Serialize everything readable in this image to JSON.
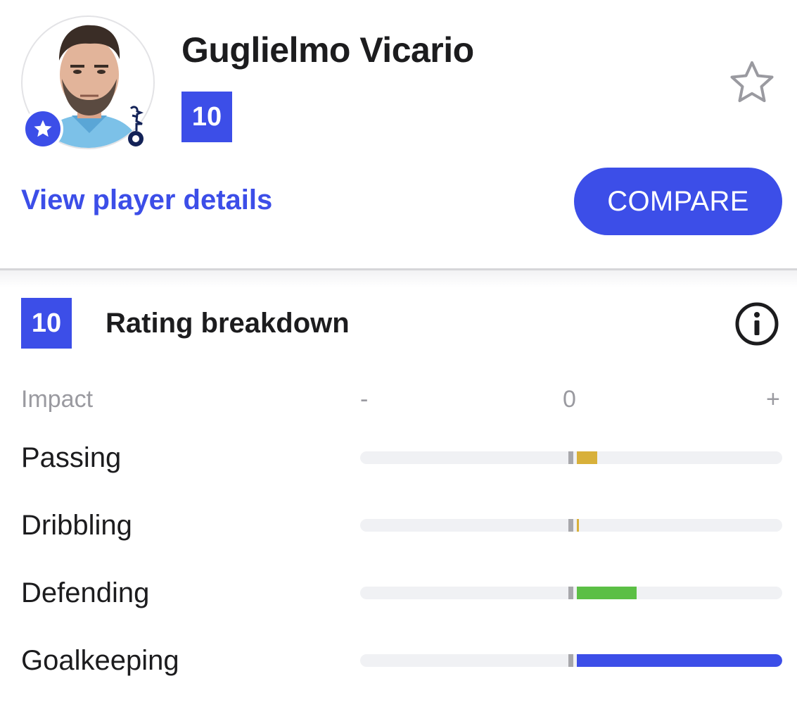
{
  "player": {
    "name": "Guglielmo Vicario",
    "rating": "10",
    "details_link": "View player details",
    "compare_label": "COMPARE"
  },
  "breakdown": {
    "rating": "10",
    "title": "Rating breakdown",
    "impact_label": "Impact",
    "scale": {
      "minus": "-",
      "zero": "0",
      "plus": "+"
    },
    "metrics": [
      {
        "label": "Passing",
        "impact": 0.1,
        "color": "#d8b03a"
      },
      {
        "label": "Dribbling",
        "impact": 0.01,
        "color": "#d8b03a"
      },
      {
        "label": "Defending",
        "impact": 0.29,
        "color": "#5bbf45"
      },
      {
        "label": "Goalkeeping",
        "impact": 1.0,
        "color": "#3c4ee8"
      }
    ]
  },
  "colors": {
    "accent": "#3c4ee8",
    "neutral_tick": "#a7a7ab",
    "track": "#f0f1f4"
  },
  "icons": {
    "avatar_badge": "star-icon",
    "club": "club-crest-icon",
    "favourite": "star-outline-icon",
    "info": "info-icon"
  }
}
